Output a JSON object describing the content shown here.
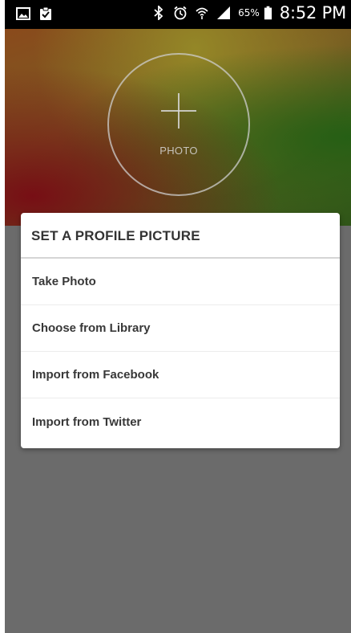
{
  "status_bar": {
    "left_icons": [
      "gallery-notification-icon",
      "clipboard-check-icon"
    ],
    "right_icons": [
      "bluetooth-icon",
      "alarm-icon",
      "wifi-icon",
      "signal-icon",
      "battery-icon"
    ],
    "battery_percent": "65%",
    "time": "8:52 PM"
  },
  "profile_photo": {
    "icon": "plus-icon",
    "label": "PHOTO"
  },
  "dialog": {
    "title": "SET A PROFILE PICTURE",
    "options": [
      {
        "label": "Take Photo"
      },
      {
        "label": "Choose from Library"
      },
      {
        "label": "Import from Facebook"
      },
      {
        "label": "Import from Twitter"
      }
    ]
  },
  "colors": {
    "status_bar": "#000000",
    "overlay": "#6b6b6b",
    "dialog_bg": "#ffffff",
    "text": "#383838"
  }
}
